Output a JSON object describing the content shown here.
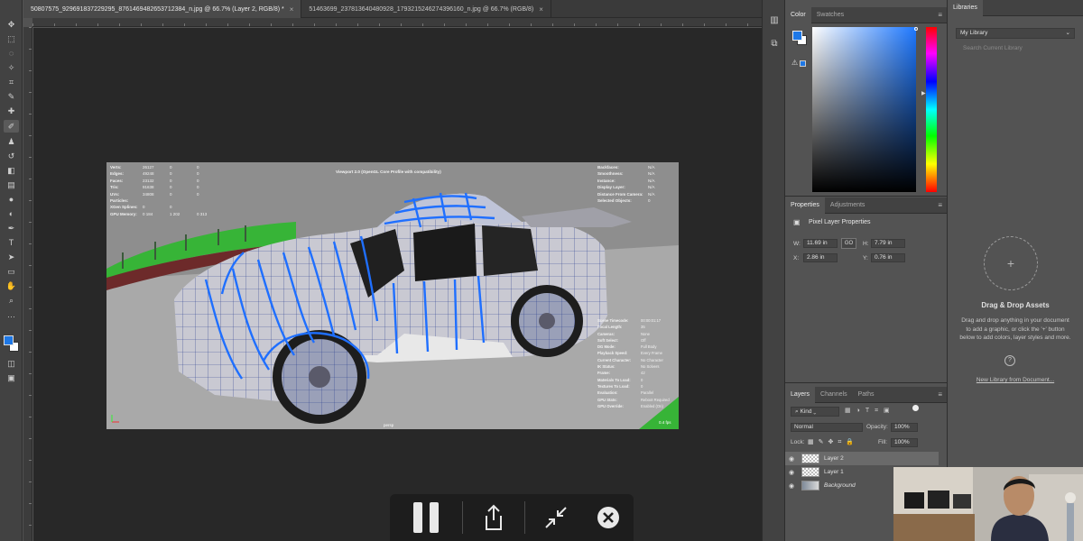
{
  "tabs": [
    {
      "label": "50807575_929691837229295_8761469482653712384_n.jpg @ 66.7% (Layer 2, RGB/8) *",
      "active": true
    },
    {
      "label": "51463699_237813640480928_1793215246274396160_n.jpg @ 66.7% (RGB/8)",
      "active": false
    }
  ],
  "tools": [
    "move-icon",
    "marquee-icon",
    "lasso-icon",
    "magic-wand-icon",
    "crop-icon",
    "eyedropper-icon",
    "healing-icon",
    "brush-icon",
    "stamp-icon",
    "history-brush-icon",
    "eraser-icon",
    "gradient-icon",
    "blur-icon",
    "dodge-icon",
    "pen-icon",
    "type-icon",
    "path-select-icon",
    "shape-icon",
    "hand-icon",
    "zoom-icon",
    "more-icon"
  ],
  "colors": {
    "foreground": "#1e78e6",
    "background": "#ffffff"
  },
  "viewport": {
    "title": "Viewport 2.0 (OpenGL Core Profile with compatibility)",
    "stats": [
      {
        "k": "Verts:",
        "a": "26127",
        "b": "0",
        "c": "0"
      },
      {
        "k": "Edges:",
        "a": "49248",
        "b": "0",
        "c": "0"
      },
      {
        "k": "Faces:",
        "a": "23132",
        "b": "0",
        "c": "0"
      },
      {
        "k": "Tris:",
        "a": "91638",
        "b": "0",
        "c": "0"
      },
      {
        "k": "UVs:",
        "a": "34808",
        "b": "0",
        "c": "0"
      },
      {
        "k": "Particles:",
        "a": "",
        "b": "",
        "c": ""
      },
      {
        "k": "XGen Splines:",
        "a": "0",
        "b": "0",
        "c": ""
      },
      {
        "k": "GPU Memory:",
        "a": "0 184",
        "b": "1 202",
        "c": "0 313"
      }
    ],
    "right_stats": [
      {
        "k": "Backfaces:",
        "v": "N/A"
      },
      {
        "k": "Smoothness:",
        "v": "N/A"
      },
      {
        "k": "Instance:",
        "v": "N/A"
      },
      {
        "k": "Display Layer:",
        "v": "N/A"
      },
      {
        "k": "Distance From Camera:",
        "v": "N/A"
      },
      {
        "k": "Selected Objects:",
        "v": "0"
      }
    ],
    "bottom_stats": [
      {
        "k": "Scene Timecode:",
        "v": "00:00:01:17"
      },
      {
        "k": "Focal Length:",
        "v": "35"
      },
      {
        "k": "Cameras:",
        "v": "None"
      },
      {
        "k": "Soft Select:",
        "v": "Off"
      },
      {
        "k": "DG Mode:",
        "v": "Full Body"
      },
      {
        "k": "Playback Speed:",
        "v": "Every Frame"
      },
      {
        "k": "Current Character:",
        "v": "No Character"
      },
      {
        "k": "IK Status:",
        "v": "No Solvers"
      },
      {
        "k": "Frame:",
        "v": "42"
      },
      {
        "k": "Materials To Load:",
        "v": "0"
      },
      {
        "k": "Textures To Load:",
        "v": "0"
      },
      {
        "k": "Evaluation:",
        "v": "Parallel"
      },
      {
        "k": "GPU Stats:",
        "v": "Reboot Required"
      },
      {
        "k": "GPU Override:",
        "v": "Enabled (On)"
      }
    ],
    "fps": "0.4 fps",
    "persp": "persp"
  },
  "color_panel": {
    "tabs": [
      "Color",
      "Swatches"
    ]
  },
  "properties_panel": {
    "tabs": [
      "Properties",
      "Adjustments"
    ],
    "heading": "Pixel Layer Properties",
    "w_label": "W:",
    "w": "11.69 in",
    "h_label": "H:",
    "h": "7.79 in",
    "x_label": "X:",
    "x": "2.86 in",
    "y_label": "Y:",
    "y": "0.76 in",
    "link": "GO"
  },
  "layers_panel": {
    "tabs": [
      "Layers",
      "Channels",
      "Paths"
    ],
    "filter": "Kind",
    "blend": "Normal",
    "opacity_label": "Opacity:",
    "opacity": "100%",
    "lock_label": "Lock:",
    "fill_label": "Fill:",
    "fill": "100%",
    "layers": [
      {
        "name": "Layer 2",
        "selected": true
      },
      {
        "name": "Layer 1",
        "selected": false
      },
      {
        "name": "Background",
        "selected": false
      }
    ]
  },
  "libraries": {
    "tab": "Libraries",
    "library": "My Library",
    "search_placeholder": "Search Current Library",
    "title": "Drag & Drop Assets",
    "text": "Drag and drop anything in your document to add a graphic, or click the '+' button below to add colors, layer styles and more.",
    "link": "New Library from Document..."
  }
}
